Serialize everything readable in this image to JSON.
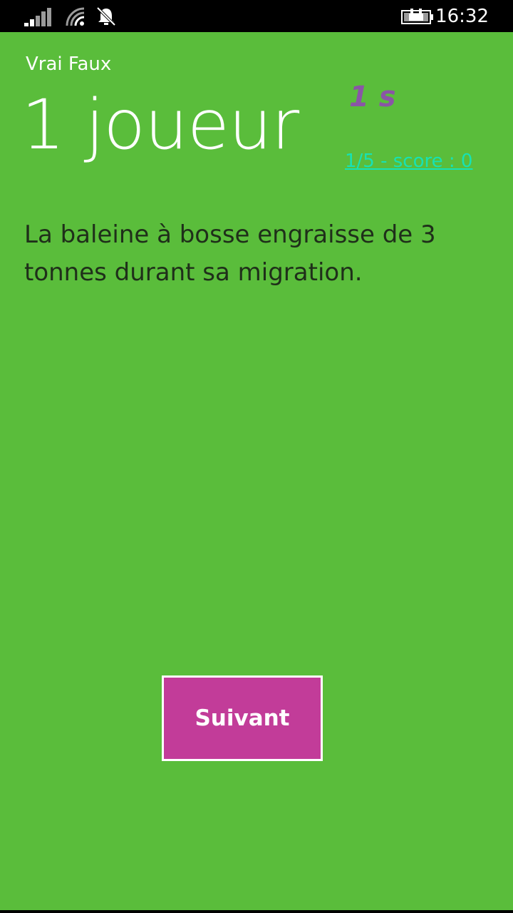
{
  "status_bar": {
    "time": "16:32",
    "icons": [
      "signal-icon",
      "wifi-icon",
      "notifications-off-icon",
      "battery-charging-icon"
    ]
  },
  "app": {
    "name": "Vrai Faux",
    "title": "1 joueur",
    "timer": "1 s",
    "score_progress": "1/5 - score : 0",
    "question": "La baleine à bosse engraisse de 3 tonnes durant sa migration.",
    "next_label": "Suivant"
  },
  "colors": {
    "background": "#5abd3b",
    "status_bar": "#000000",
    "timer": "#8a55a6",
    "score_link": "#17e2b4",
    "button": "#c23c99",
    "button_border": "#ffffff",
    "question_text": "#1f2f1a"
  }
}
